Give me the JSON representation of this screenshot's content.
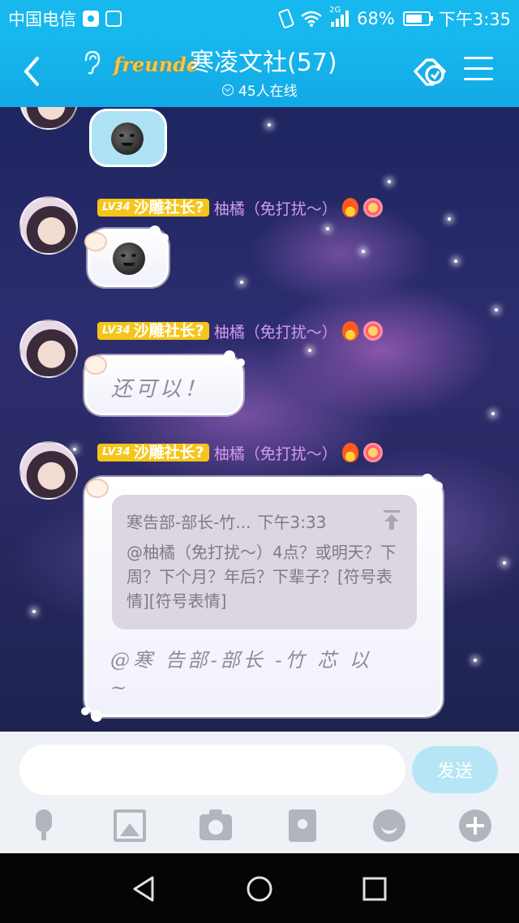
{
  "status_bar": {
    "carrier": "中国电信",
    "network_type": "2G",
    "battery": "68%",
    "battery_level": 0.68,
    "time": "下午3:35"
  },
  "header": {
    "badge_text": "freunde",
    "title": "寒凌文社(57)",
    "online": "45人在线"
  },
  "messages": [
    {
      "type": "sticker",
      "content": "moon-face-emoji"
    },
    {
      "type": "sticker",
      "level": "LV34",
      "rank": "沙雕社长?",
      "nickname": "柚橘（免打扰～）",
      "content": "moon-face-emoji"
    },
    {
      "type": "text",
      "level": "LV34",
      "rank": "沙雕社长?",
      "nickname": "柚橘（免打扰～）",
      "text": "还可以！"
    },
    {
      "type": "reply",
      "level": "LV34",
      "rank": "沙雕社长?",
      "nickname": "柚橘（免打扰～）",
      "quote_sender": "寒告部-部长-竹...",
      "quote_time": "下午3:33",
      "quote_text": "@柚橘（免打扰～）4点？或明天？下周？下个月？年后？下辈子？[符号表情][符号表情]",
      "text_line1": "@寒 告部-部长 -竹 芯 以",
      "text_line2": "~"
    }
  ],
  "input": {
    "value": "",
    "send_label": "发送"
  },
  "toolbar": [
    "mic-icon",
    "image-icon",
    "camera-icon",
    "red-packet-icon",
    "emoji-icon",
    "plus-icon"
  ],
  "colors": {
    "header": "#16b8ee",
    "send_button": "#b6e6f6",
    "nickname": "#d49bf0",
    "level_badge": "#f5c518"
  }
}
